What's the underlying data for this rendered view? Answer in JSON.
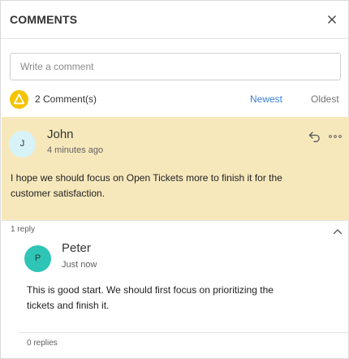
{
  "header": {
    "title": "COMMENTS",
    "close_icon": "close-icon"
  },
  "composer": {
    "placeholder": "Write a comment",
    "value": ""
  },
  "toolbar": {
    "count_icon": "comments-badge-icon",
    "count_label": "2 Comment(s)",
    "sort_newest": "Newest",
    "sort_oldest": "Oldest",
    "active_sort": "Newest"
  },
  "comments": [
    {
      "avatar_initial": "J",
      "author": "John",
      "time": "4 minutes ago",
      "body": "I hope we should focus on Open Tickets more to finish it for the customer satisfaction.",
      "reply_icon": "reply-icon",
      "more_icon": "more-options-icon",
      "reply_count_label": "1 reply",
      "collapse_icon": "chevron-up-icon",
      "replies": [
        {
          "avatar_initial": "P",
          "author": "Peter",
          "time": "Just now",
          "body": "This is good start. We should first focus on prioritizing the tickets and finish it.",
          "reply_count_label": "0 replies"
        }
      ]
    }
  ],
  "colors": {
    "accent_link": "#3b7fd4",
    "highlight_bg": "#f7e8bc",
    "badge": "#f5c400",
    "avatar_j": "#d7f3f7",
    "avatar_p": "#2ec4b6"
  }
}
